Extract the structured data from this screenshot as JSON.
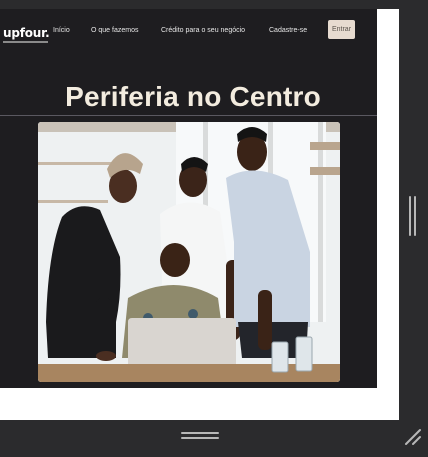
{
  "site": {
    "logo": "upfour.",
    "nav": {
      "items": [
        "Início",
        "O que fazemos",
        "Crédito para o seu negócio",
        "Cadastre-se"
      ],
      "cta_label": "Entrar"
    },
    "hero": {
      "title": "Periferia no Centro"
    }
  },
  "colors": {
    "site_background": "#1e1d20",
    "title_color": "#f3ecdf",
    "button_background": "#e7dbd0",
    "page_background": "#ffffff",
    "frame_background": "#2b2b2d"
  },
  "icons": {
    "vertical_grip": "vertical-drag-handle-icon",
    "horizontal_grip": "horizontal-drag-handle-icon",
    "resize": "resize-corner-icon"
  }
}
